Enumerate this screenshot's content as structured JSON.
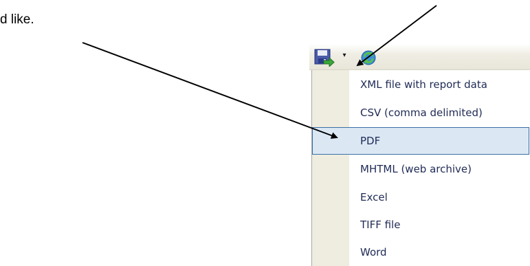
{
  "document": {
    "text_fragment": "d like."
  },
  "toolbar": {
    "export_icon": "save-export-icon",
    "dropdown_icon": "triangle-down",
    "refresh_icon": "refresh-icon"
  },
  "menu": {
    "items": [
      {
        "label": "XML file with report data",
        "selected": false
      },
      {
        "label": "CSV (comma delimited)",
        "selected": false
      },
      {
        "label": "PDF",
        "selected": true
      },
      {
        "label": "MHTML (web archive)",
        "selected": false
      },
      {
        "label": "Excel",
        "selected": false
      },
      {
        "label": "TIFF file",
        "selected": false
      },
      {
        "label": "Word",
        "selected": false
      }
    ]
  },
  "colors": {
    "selection_border": "#3a6ea5",
    "selection_fill": "#dbe8f4",
    "menu_text": "#1f2a55",
    "gutter": "#efede0"
  }
}
